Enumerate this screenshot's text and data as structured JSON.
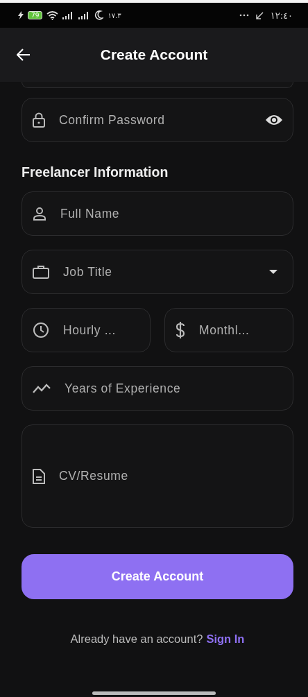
{
  "status_bar": {
    "battery": "79",
    "clock_small": "١٧.٣",
    "time": "١٢:٤٠"
  },
  "header": {
    "title": "Create Account"
  },
  "confirm_password": {
    "placeholder": "Confirm Password"
  },
  "section_title": "Freelancer Information",
  "rows": [
    [
      {
        "kind": "name",
        "placeholder": "Full Name"
      }
    ],
    [
      {
        "kind": "job",
        "placeholder": "Job Title"
      }
    ],
    [
      {
        "kind": "hourly",
        "placeholder": "Hourly ..."
      },
      {
        "kind": "monthly",
        "placeholder": "Monthl..."
      }
    ],
    [
      {
        "kind": "experience",
        "placeholder": "Years of Experience"
      }
    ],
    [
      {
        "kind": "cv",
        "placeholder": "CV/Resume"
      }
    ]
  ],
  "submit": {
    "label": "Create Account"
  },
  "footer": {
    "text": "Already have an account?",
    "link": "Sign In"
  }
}
